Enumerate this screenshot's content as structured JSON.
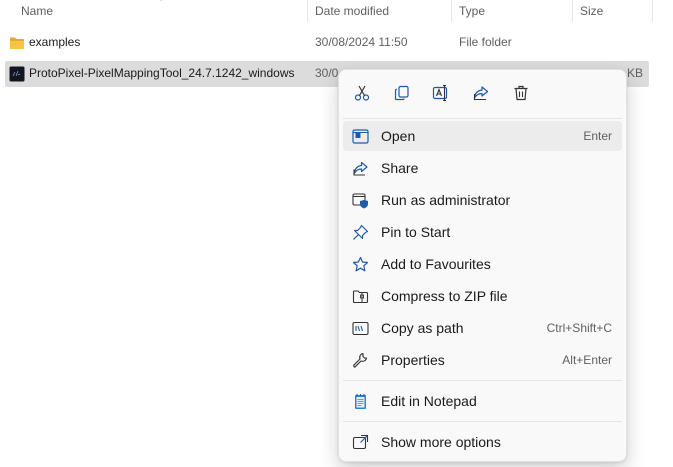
{
  "header": {
    "name_label": "Name",
    "date_label": "Date modified",
    "type_label": "Type",
    "size_label": "Size"
  },
  "files": [
    {
      "name": "examples",
      "date": "30/08/2024 11:50",
      "type": "File folder",
      "size": "",
      "icon": "folder-icon"
    },
    {
      "name": "ProtoPixel-PixelMappingTool_24.7.1242_windows",
      "date": "30/0",
      "type": "",
      "size": "KB",
      "icon": "exe-app-icon"
    }
  ],
  "context_menu": {
    "quick_actions": [
      {
        "icon": "cut-icon"
      },
      {
        "icon": "copy-icon"
      },
      {
        "icon": "rename-icon"
      },
      {
        "icon": "share-icon"
      },
      {
        "icon": "delete-icon"
      }
    ],
    "items": [
      {
        "label": "Open",
        "accel": "Enter",
        "icon": "open-app-icon"
      },
      {
        "label": "Share",
        "accel": "",
        "icon": "share-icon"
      },
      {
        "label": "Run as administrator",
        "accel": "",
        "icon": "admin-shield-icon"
      },
      {
        "label": "Pin to Start",
        "accel": "",
        "icon": "pin-icon"
      },
      {
        "label": "Add to Favourites",
        "accel": "",
        "icon": "star-icon"
      },
      {
        "label": "Compress to ZIP file",
        "accel": "",
        "icon": "zip-icon"
      },
      {
        "label": "Copy as path",
        "accel": "Ctrl+Shift+C",
        "icon": "copy-path-icon"
      },
      {
        "label": "Properties",
        "accel": "Alt+Enter",
        "icon": "wrench-icon"
      },
      {
        "label": "Edit in Notepad",
        "accel": "",
        "icon": "notepad-icon"
      },
      {
        "label": "Show more options",
        "accel": "",
        "icon": "more-options-icon"
      }
    ]
  },
  "colors": {
    "accent": "#0067c0",
    "selected_row": "#dcdcdc",
    "menu_bg": "#f9f9f9",
    "folder": "#f8c445"
  }
}
